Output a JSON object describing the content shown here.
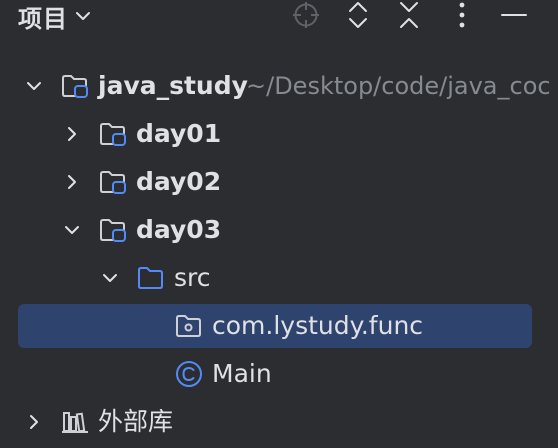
{
  "header": {
    "title": "项目",
    "icons": [
      "chevron-down-icon",
      "locate-icon",
      "expand-all-icon",
      "collapse-all-icon",
      "more-icon",
      "minimize-icon"
    ]
  },
  "colors": {
    "background": "#2b2d30",
    "selection": "#2e436e",
    "text": "#dfe1e5",
    "muted_text": "#868a91",
    "module_badge": "#548af7",
    "class_icon": "#548af7"
  },
  "tree": {
    "root": {
      "label": "java_study",
      "path": "~/Desktop/code/java_coc",
      "expanded": true
    },
    "day01": {
      "label": "day01",
      "expanded": false
    },
    "day02": {
      "label": "day02",
      "expanded": false
    },
    "day03": {
      "label": "day03",
      "expanded": true
    },
    "src": {
      "label": "src",
      "expanded": true
    },
    "package": {
      "label": "com.lystudy.func",
      "selected": true
    },
    "main": {
      "label": "Main"
    },
    "libraries": {
      "label": "外部库",
      "expanded": false
    }
  }
}
